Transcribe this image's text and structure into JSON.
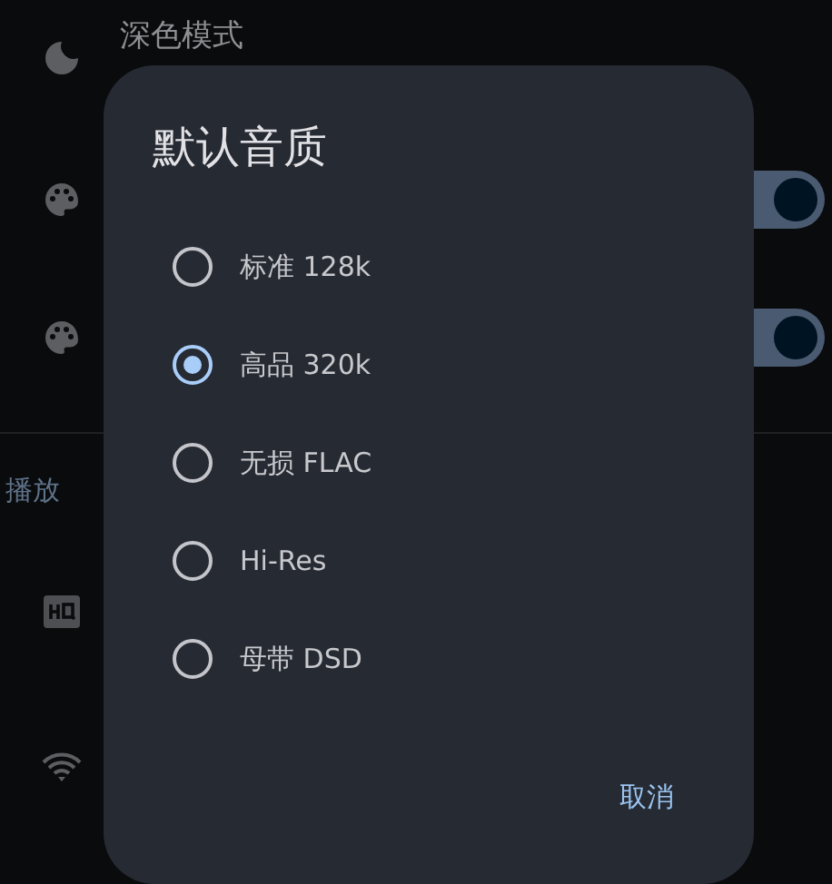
{
  "settings": [
    {
      "kind": "text",
      "title": "深色模式"
    },
    {
      "kind": "toggle",
      "on": true
    },
    {
      "kind": "toggle",
      "on": true
    },
    {
      "kind": "header",
      "title": "播放"
    },
    {
      "kind": "icon"
    },
    {
      "kind": "icon"
    }
  ],
  "dialog": {
    "title": "默认音质",
    "options": [
      {
        "label": "标准 128k",
        "selected": false
      },
      {
        "label": "高品 320k",
        "selected": true
      },
      {
        "label": "无损 FLAC",
        "selected": false
      },
      {
        "label": "Hi-Res",
        "selected": false
      },
      {
        "label": "母带 DSD",
        "selected": false
      }
    ],
    "buttons": [
      {
        "label": "取消"
      }
    ]
  }
}
